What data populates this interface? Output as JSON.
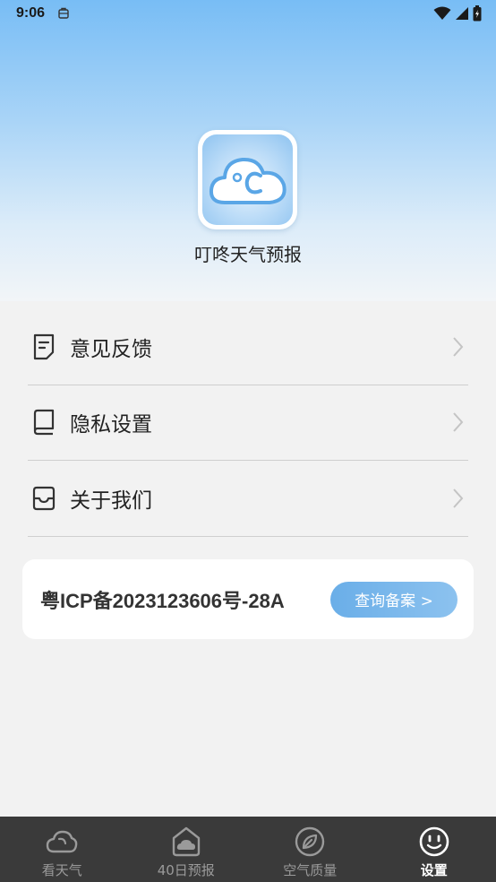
{
  "status_bar": {
    "time": "9:06"
  },
  "app": {
    "name": "叮咚天气预报"
  },
  "menu": {
    "items": [
      {
        "label": "意见反馈",
        "icon": "document-icon"
      },
      {
        "label": "隐私设置",
        "icon": "book-icon"
      },
      {
        "label": "关于我们",
        "icon": "inbox-icon"
      }
    ]
  },
  "icp": {
    "text": "粤ICP备2023123606号-28A",
    "button_label": "查询备案 >"
  },
  "tabbar": {
    "tabs": [
      {
        "label": "看天气",
        "icon": "cloud-icon",
        "active": false
      },
      {
        "label": "40日预报",
        "icon": "forecast-icon",
        "active": false
      },
      {
        "label": "空气质量",
        "icon": "leaf-icon",
        "active": false
      },
      {
        "label": "设置",
        "icon": "smiley-icon",
        "active": true
      }
    ]
  },
  "colors": {
    "accent": "#6aaee8",
    "tabbar_bg": "#3a3a3a",
    "page_bg": "#f2f2f2"
  }
}
